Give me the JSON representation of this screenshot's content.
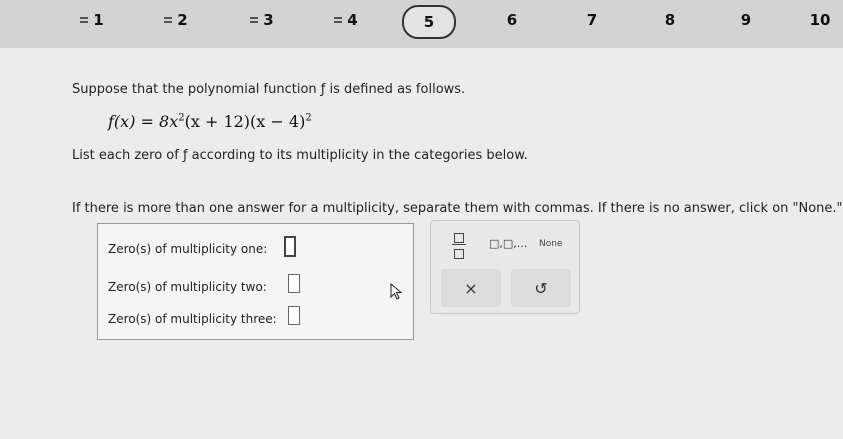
{
  "nav": {
    "questions": [
      {
        "label": "1",
        "flagged": true
      },
      {
        "label": "2",
        "flagged": true
      },
      {
        "label": "3",
        "flagged": true
      },
      {
        "label": "4",
        "flagged": true
      },
      {
        "label": "5",
        "flagged": false,
        "current": true
      },
      {
        "label": "6",
        "flagged": false
      },
      {
        "label": "7",
        "flagged": false
      },
      {
        "label": "8",
        "flagged": false
      },
      {
        "label": "9",
        "flagged": false
      },
      {
        "label": "10",
        "flagged": false
      }
    ]
  },
  "problem": {
    "intro": "Suppose that the polynomial function ƒ is defined as follows.",
    "eq_lhs": "f(x) = 8x",
    "eq_exp1": "2",
    "eq_mid": "(x + 12)(x − 4)",
    "eq_exp2": "2",
    "instruction": "List each zero of ƒ according to its multiplicity in the categories below.",
    "note": "If there is more than one answer for a multiplicity, separate them with commas. If there is no answer, click on \"None.\""
  },
  "answers": {
    "row1_label": "Zero(s) of multiplicity one:",
    "row2_label": "Zero(s) of multiplicity two:",
    "row3_label": "Zero(s) of multiplicity three:"
  },
  "tools": {
    "list_label": "□,□,...",
    "none_label": "None",
    "clear_symbol": "×",
    "undo_symbol": "↺"
  }
}
